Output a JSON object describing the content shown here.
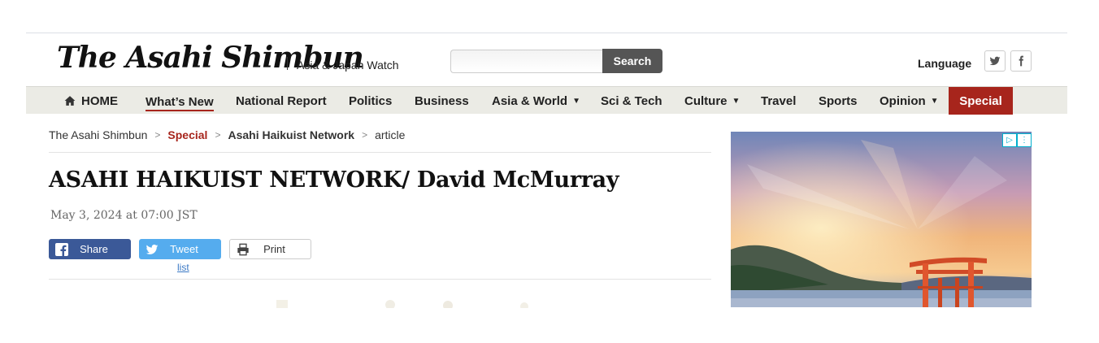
{
  "header": {
    "logo_text": "The Asahi Shimbun",
    "tagline": "Asia & Japan Watch",
    "search_placeholder": "",
    "search_label": "Search",
    "language_label": "Language"
  },
  "nav": {
    "home": "HOME",
    "items": [
      {
        "label": "What’s New"
      },
      {
        "label": "National Report"
      },
      {
        "label": "Politics"
      },
      {
        "label": "Business"
      },
      {
        "label": "Asia & World"
      },
      {
        "label": "Sci & Tech"
      },
      {
        "label": "Culture"
      },
      {
        "label": "Travel"
      },
      {
        "label": "Sports"
      },
      {
        "label": "Opinion"
      },
      {
        "label": "Special"
      }
    ]
  },
  "breadcrumb": {
    "root": "The Asahi Shimbun",
    "sep": ">",
    "section": "Special",
    "subsection": "Asahi Haikuist Network",
    "current": "article"
  },
  "article": {
    "headline": "ASAHI HAIKUIST NETWORK/ David McMurray",
    "date": "May 3, 2024 at 07:00 JST"
  },
  "share": {
    "facebook": "Share",
    "twitter": "Tweet",
    "print": "Print",
    "list": "list"
  },
  "colors": {
    "accent": "#a7251c",
    "facebook": "#3b5998",
    "twitter": "#55acee",
    "nav_bg": "#ebebe5"
  },
  "icons": [
    "home-icon",
    "twitter-icon",
    "facebook-icon",
    "print-icon",
    "ad-choices-icon"
  ]
}
